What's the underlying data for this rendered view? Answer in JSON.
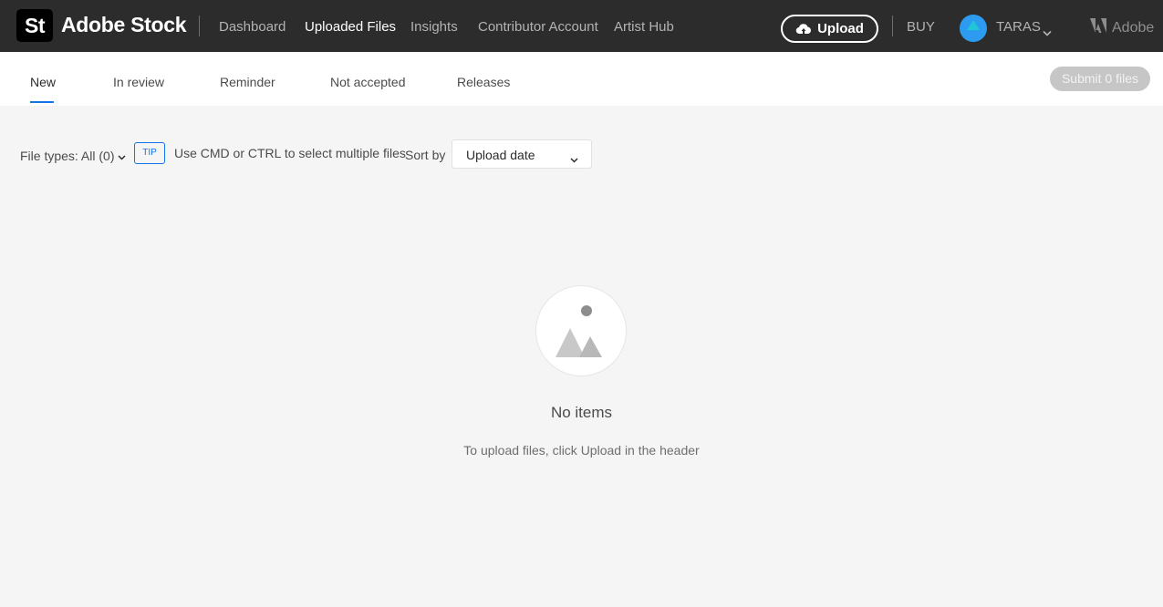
{
  "header": {
    "logo_text": "St",
    "brand": "Adobe Stock",
    "nav": [
      {
        "label": "Dashboard",
        "active": false
      },
      {
        "label": "Uploaded Files",
        "active": true
      },
      {
        "label": "Insights",
        "active": false
      },
      {
        "label": "Contributor Account",
        "active": false
      },
      {
        "label": "Artist Hub",
        "active": false
      }
    ],
    "upload_label": "Upload",
    "buy_label": "BUY",
    "user_name": "TARAS",
    "adobe_label": "Adobe"
  },
  "tabs": {
    "items": [
      {
        "label": "New",
        "active": true
      },
      {
        "label": "In review",
        "active": false
      },
      {
        "label": "Reminder",
        "active": false
      },
      {
        "label": "Not accepted",
        "active": false
      },
      {
        "label": "Releases",
        "active": false
      }
    ],
    "submit_label": "Submit 0 files"
  },
  "filters": {
    "file_types_label": "File types: All (0)",
    "tip_badge": "TIP",
    "tip_text": "Use CMD or CTRL to select multiple files",
    "sort_by_label": "Sort by",
    "sort_value": "Upload date"
  },
  "empty_state": {
    "title": "No items",
    "subtitle": "To upload files, click Upload in the header"
  },
  "colors": {
    "header_bg": "#2c2c2c",
    "accent": "#1473e6",
    "page_bg": "#f5f5f5"
  }
}
